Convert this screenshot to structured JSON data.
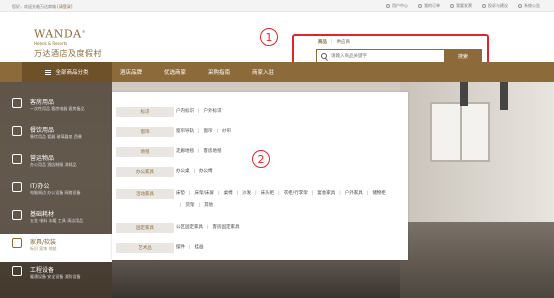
{
  "topbar": {
    "welcome_prefix": "您好，欢迎光临万达商城",
    "welcome_link": "[请登录]",
    "links": [
      "用户中心",
      "我的订单",
      "我要发票",
      "投诉与建议",
      "系统公告"
    ]
  },
  "brand": {
    "name": "WANDA",
    "tm": "®",
    "sub": "Hotels & Resorts",
    "cn": "万达酒店及度假村"
  },
  "search": {
    "tabs": [
      "商品",
      "供应商"
    ],
    "placeholder": "请输入商品关键字",
    "button": "搜索"
  },
  "markers": [
    "1",
    "2"
  ],
  "nav": {
    "category_button": "全部商品分类",
    "items": [
      "酒店品牌",
      "优选商家",
      "采购指南",
      "商家入驻"
    ]
  },
  "categories": [
    {
      "title": "客房用品",
      "sub": "一次性用品 客房电器 客房备品"
    },
    {
      "title": "餐饮用品",
      "sub": "餐饮用品 瓷器 玻璃器皿 西餐"
    },
    {
      "title": "营运物品",
      "sub": "办公用品 酒店制服 消耗品"
    },
    {
      "title": "IT/办公",
      "sub": "电脑周边 办公设备 网络设备"
    },
    {
      "title": "基础耗材",
      "sub": "五金 电料 水暖 工具 清洁用品"
    },
    {
      "title": "家具/软装",
      "sub": "标识 家饰 地毯"
    },
    {
      "title": "工程设备",
      "sub": "暖通设备 安全设备 消防设备"
    }
  ],
  "panel": {
    "rows": [
      {
        "label": "标识",
        "items": [
          "户内标识",
          "户外标识"
        ]
      },
      {
        "label": "窗饰",
        "items": [
          "窗帘导轨",
          "窗帘",
          "纱帘"
        ]
      },
      {
        "label": "地毯",
        "items": [
          "走廊地毯",
          "客房地毯"
        ]
      },
      {
        "label": "办公家具",
        "items": [
          "办公桌",
          "办公椅"
        ]
      },
      {
        "label": "活动家具",
        "items": [
          "床垫",
          "床架/床屏",
          "桌椅",
          "沙发",
          "床头柜",
          "衣柜/行李架",
          "宴会家具",
          "户外家具",
          "储物柜",
          "货架",
          "其他"
        ]
      },
      {
        "label": "固定家具",
        "items": [
          "公区固定家具",
          "客房固定家具"
        ]
      },
      {
        "label": "艺术品",
        "items": [
          "摆件",
          "挂画"
        ]
      }
    ]
  },
  "colors": {
    "brand": "#8c6a3a",
    "highlight": "#e2252b"
  }
}
